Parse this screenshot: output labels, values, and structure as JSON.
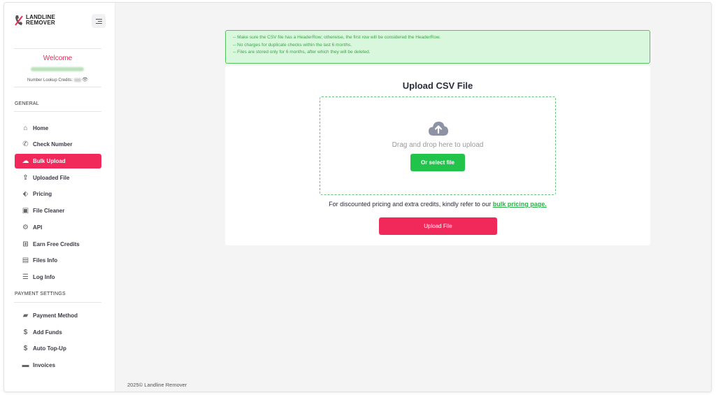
{
  "brand": {
    "line1": "LANDLINE",
    "line2": "REMOVER"
  },
  "user": {
    "welcome": "Welcome",
    "credits_label": "Number Lookup Credits:"
  },
  "sidebar": {
    "general_title": "GENERAL",
    "general_items": [
      {
        "label": "Home",
        "icon": "home-icon"
      },
      {
        "label": "Check Number",
        "icon": "phone-icon"
      },
      {
        "label": "Bulk Upload",
        "icon": "cloud-upload-icon",
        "active": true
      },
      {
        "label": "Uploaded File",
        "icon": "upload-icon"
      },
      {
        "label": "Pricing",
        "icon": "tag-icon"
      },
      {
        "label": "File Cleaner",
        "icon": "file-cleaner-icon"
      },
      {
        "label": "API",
        "icon": "api-icon"
      },
      {
        "label": "Earn Free Credits",
        "icon": "gift-icon"
      },
      {
        "label": "Files Info",
        "icon": "clipboard-icon"
      },
      {
        "label": "Log Info",
        "icon": "log-icon"
      }
    ],
    "payment_title": "PAYMENT SETTINGS",
    "payment_items": [
      {
        "label": "Payment Method",
        "icon": "card-icon"
      },
      {
        "label": "Add Funds",
        "icon": "dollar-icon"
      },
      {
        "label": "Auto Top-Up",
        "icon": "dollar-icon"
      },
      {
        "label": "Invoices",
        "icon": "invoice-icon"
      }
    ]
  },
  "notice": {
    "lines": [
      "-- Make sure the CSV file has a HeaderRow; otherwise, the first row will be considered the HeaderRow.",
      "-- No charges for duplicate checks within the last 6 months.",
      "-- Files are stored only for 6 months, after which they will be deleted."
    ]
  },
  "upload": {
    "title": "Upload CSV File",
    "drag_text": "Drag and drop here to upload",
    "select_label": "Or select file",
    "pricing_text": "For discounted pricing and extra credits, kindly refer to our ",
    "pricing_link": "bulk pricing page.",
    "upload_label": "Upload File"
  },
  "footer": {
    "text": "2025© Landline Remover"
  },
  "colors": {
    "accent": "#f0295a",
    "green": "#22c34b",
    "notice_bg": "#d9f7dc"
  }
}
